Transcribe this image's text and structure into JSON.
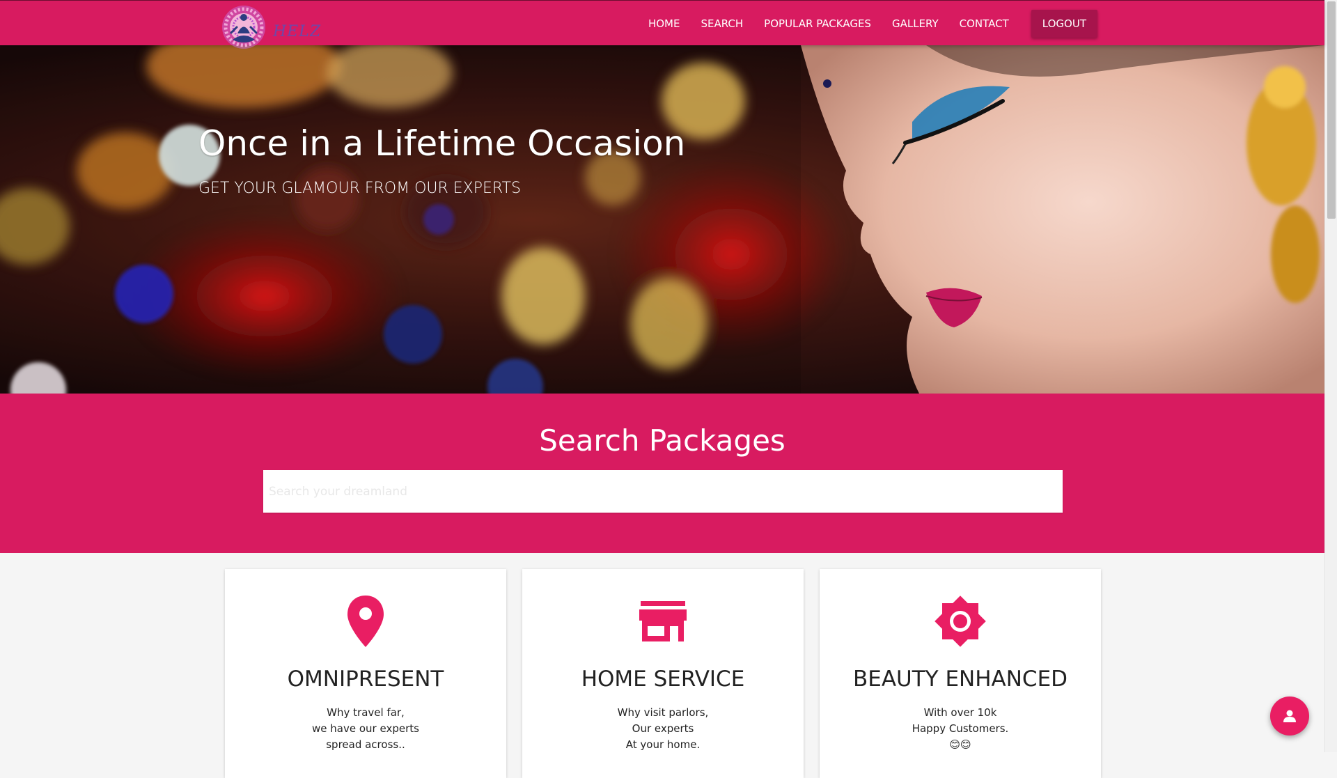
{
  "nav": {
    "logo_text": "HELZ",
    "links": [
      "HOME",
      "SEARCH",
      "POPULAR PACKAGES",
      "GALLERY",
      "CONTACT"
    ],
    "logout_label": "LOGOUT"
  },
  "hero": {
    "title": "Once in a Lifetime Occasion",
    "subtitle": "GET YOUR GLAMOUR FROM OUR EXPERTS"
  },
  "search": {
    "title": "Search Packages",
    "placeholder": "Search your dreamland",
    "value": ""
  },
  "features": [
    {
      "icon": "map-pin-icon",
      "title": "OMNIPRESENT",
      "lines": [
        "Why travel far,",
        "we have our experts",
        "spread across.."
      ]
    },
    {
      "icon": "store-icon",
      "title": "HOME SERVICE",
      "lines": [
        "Why visit parlors,",
        "Our experts",
        "At your home."
      ]
    },
    {
      "icon": "brightness-icon",
      "title": "BEAUTY ENHANCED",
      "lines": [
        "With over 10k",
        "Happy Customers.",
        "😊😊"
      ]
    }
  ],
  "fab": {
    "icon": "person-icon"
  },
  "colors": {
    "brand": "#d81b60",
    "brand_dark": "#a7144c",
    "icon_accent": "#e91e63",
    "page_background": "#f5f5f5"
  }
}
